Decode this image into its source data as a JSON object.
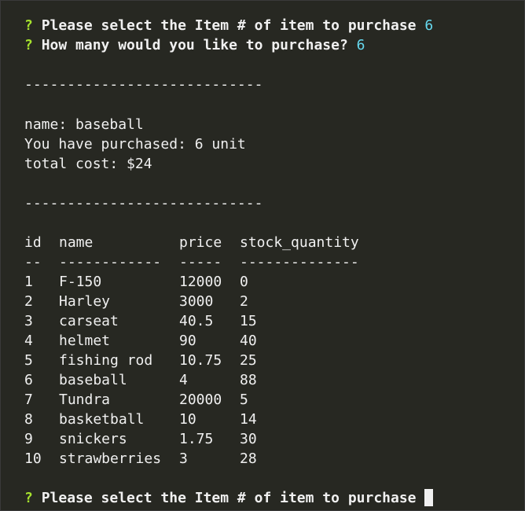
{
  "prompts": [
    {
      "mark": "?",
      "text": "Please select the Item # of item to purchase",
      "answer": "6"
    },
    {
      "mark": "?",
      "text": "How many would you like to purchase?",
      "answer": "6"
    }
  ],
  "separator": "----------------------------",
  "receipt": {
    "name_line": "name: baseball",
    "purchased_line": "You have purchased: 6 unit",
    "cost_line": "total cost: $24"
  },
  "table": {
    "headers": [
      "id",
      "name",
      "price",
      "stock_quantity"
    ],
    "underlines": [
      "--",
      "------------",
      "-----",
      "--------------"
    ],
    "rows": [
      {
        "id": "1",
        "name": "F-150",
        "price": "12000",
        "stock": "0"
      },
      {
        "id": "2",
        "name": "Harley",
        "price": "3000",
        "stock": "2"
      },
      {
        "id": "3",
        "name": "carseat",
        "price": "40.5",
        "stock": "15"
      },
      {
        "id": "4",
        "name": "helmet",
        "price": "90",
        "stock": "40"
      },
      {
        "id": "5",
        "name": "fishing rod",
        "price": "10.75",
        "stock": "25"
      },
      {
        "id": "6",
        "name": "baseball",
        "price": "4",
        "stock": "88"
      },
      {
        "id": "7",
        "name": "Tundra",
        "price": "20000",
        "stock": "5"
      },
      {
        "id": "8",
        "name": "basketball",
        "price": "10",
        "stock": "14"
      },
      {
        "id": "9",
        "name": "snickers",
        "price": "1.75",
        "stock": "30"
      },
      {
        "id": "10",
        "name": "strawberries",
        "price": "3",
        "stock": "28"
      }
    ]
  },
  "final_prompt": {
    "mark": "?",
    "text": "Please select the Item # of item to purchase"
  }
}
